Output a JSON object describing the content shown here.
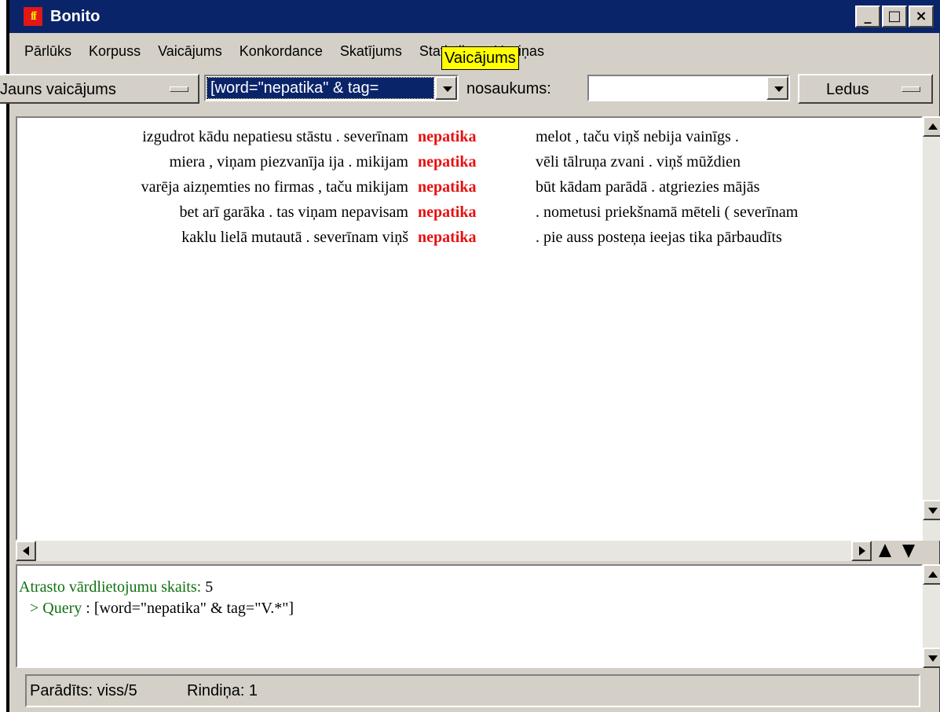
{
  "window": {
    "title": "Bonito",
    "icon": "ff",
    "minimize_symbol": "_",
    "maximize_symbol": "□",
    "close_symbol": "×"
  },
  "menu": [
    "Pārlūks",
    "Korpuss",
    "Vaicājums",
    "Konkordance",
    "Skatījums",
    "Statistika",
    "Uzziņas"
  ],
  "tooltip": "Vaicājums",
  "toolbar": {
    "new_query_label": "Jauns vaicājums",
    "query_value": "[word=\"nepatika\" & tag=",
    "name_label": "nosaukums:",
    "name_value": "",
    "ice_label": "Ledus"
  },
  "concordance": {
    "keyword_color": "#e81010",
    "lines": [
      {
        "left": "izgudrot kādu nepatiesu stāstu . severīnam",
        "kwic": "nepatika",
        "right": "melot , taču viņš nebija vainīgs ."
      },
      {
        "left": "miera , viņam piezvanīja ija . mikijam",
        "kwic": "nepatika",
        "right": "vēli tālruņa zvani . viņš mūždien"
      },
      {
        "left": "varēja aizņemties no firmas , taču mikijam",
        "kwic": "nepatika",
        "right": "būt kādam parādā . atgriezies mājās"
      },
      {
        "left": "bet arī garāka . tas viņam nepavisam",
        "kwic": "nepatika",
        "right": ". nometusi priekšnamā mēteli ( severīnam"
      },
      {
        "left": "kaklu lielā mutautā . severīnam viņš",
        "kwic": "nepatika",
        "right": ". pie auss posteņa ieejas tika pārbaudīts"
      }
    ]
  },
  "info": {
    "count_label": "Atrasto vārdlietojumu skaits:",
    "count_value": "5",
    "query_label": "> Query",
    "query_value": ": [word=\"nepatika\" & tag=\"V.*\"]",
    "label_color": "#107010"
  },
  "status": {
    "shown": "Parādīts: viss/5",
    "row": "Rindiņa: 1"
  }
}
